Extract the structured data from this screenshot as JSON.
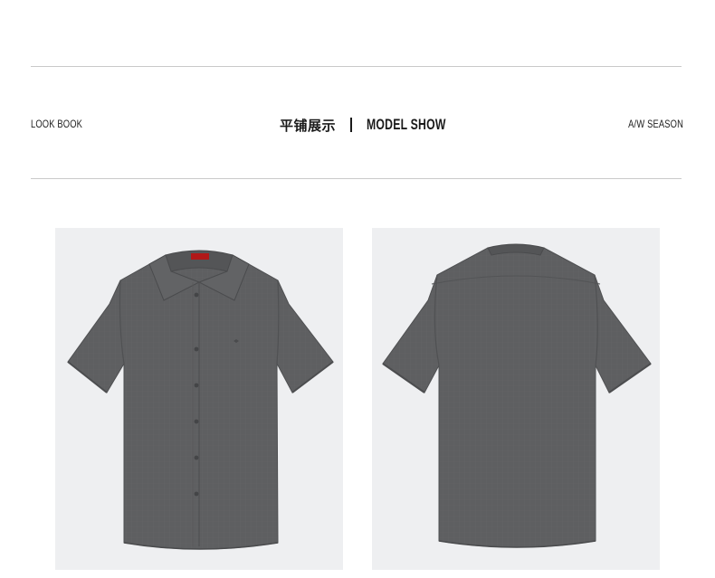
{
  "header": {
    "left_label": "LOOK BOOK",
    "title_cn": "平铺展示",
    "title_en": "MODEL SHOW",
    "right_label": "A/W SEASON"
  },
  "colors": {
    "shirt": "#5d5e60",
    "panel_background": "#eeeff1",
    "divider": "#c9c9c9",
    "label_accent": "#b01818"
  },
  "images": [
    {
      "name": "shirt-front-image"
    },
    {
      "name": "shirt-back-image"
    }
  ]
}
